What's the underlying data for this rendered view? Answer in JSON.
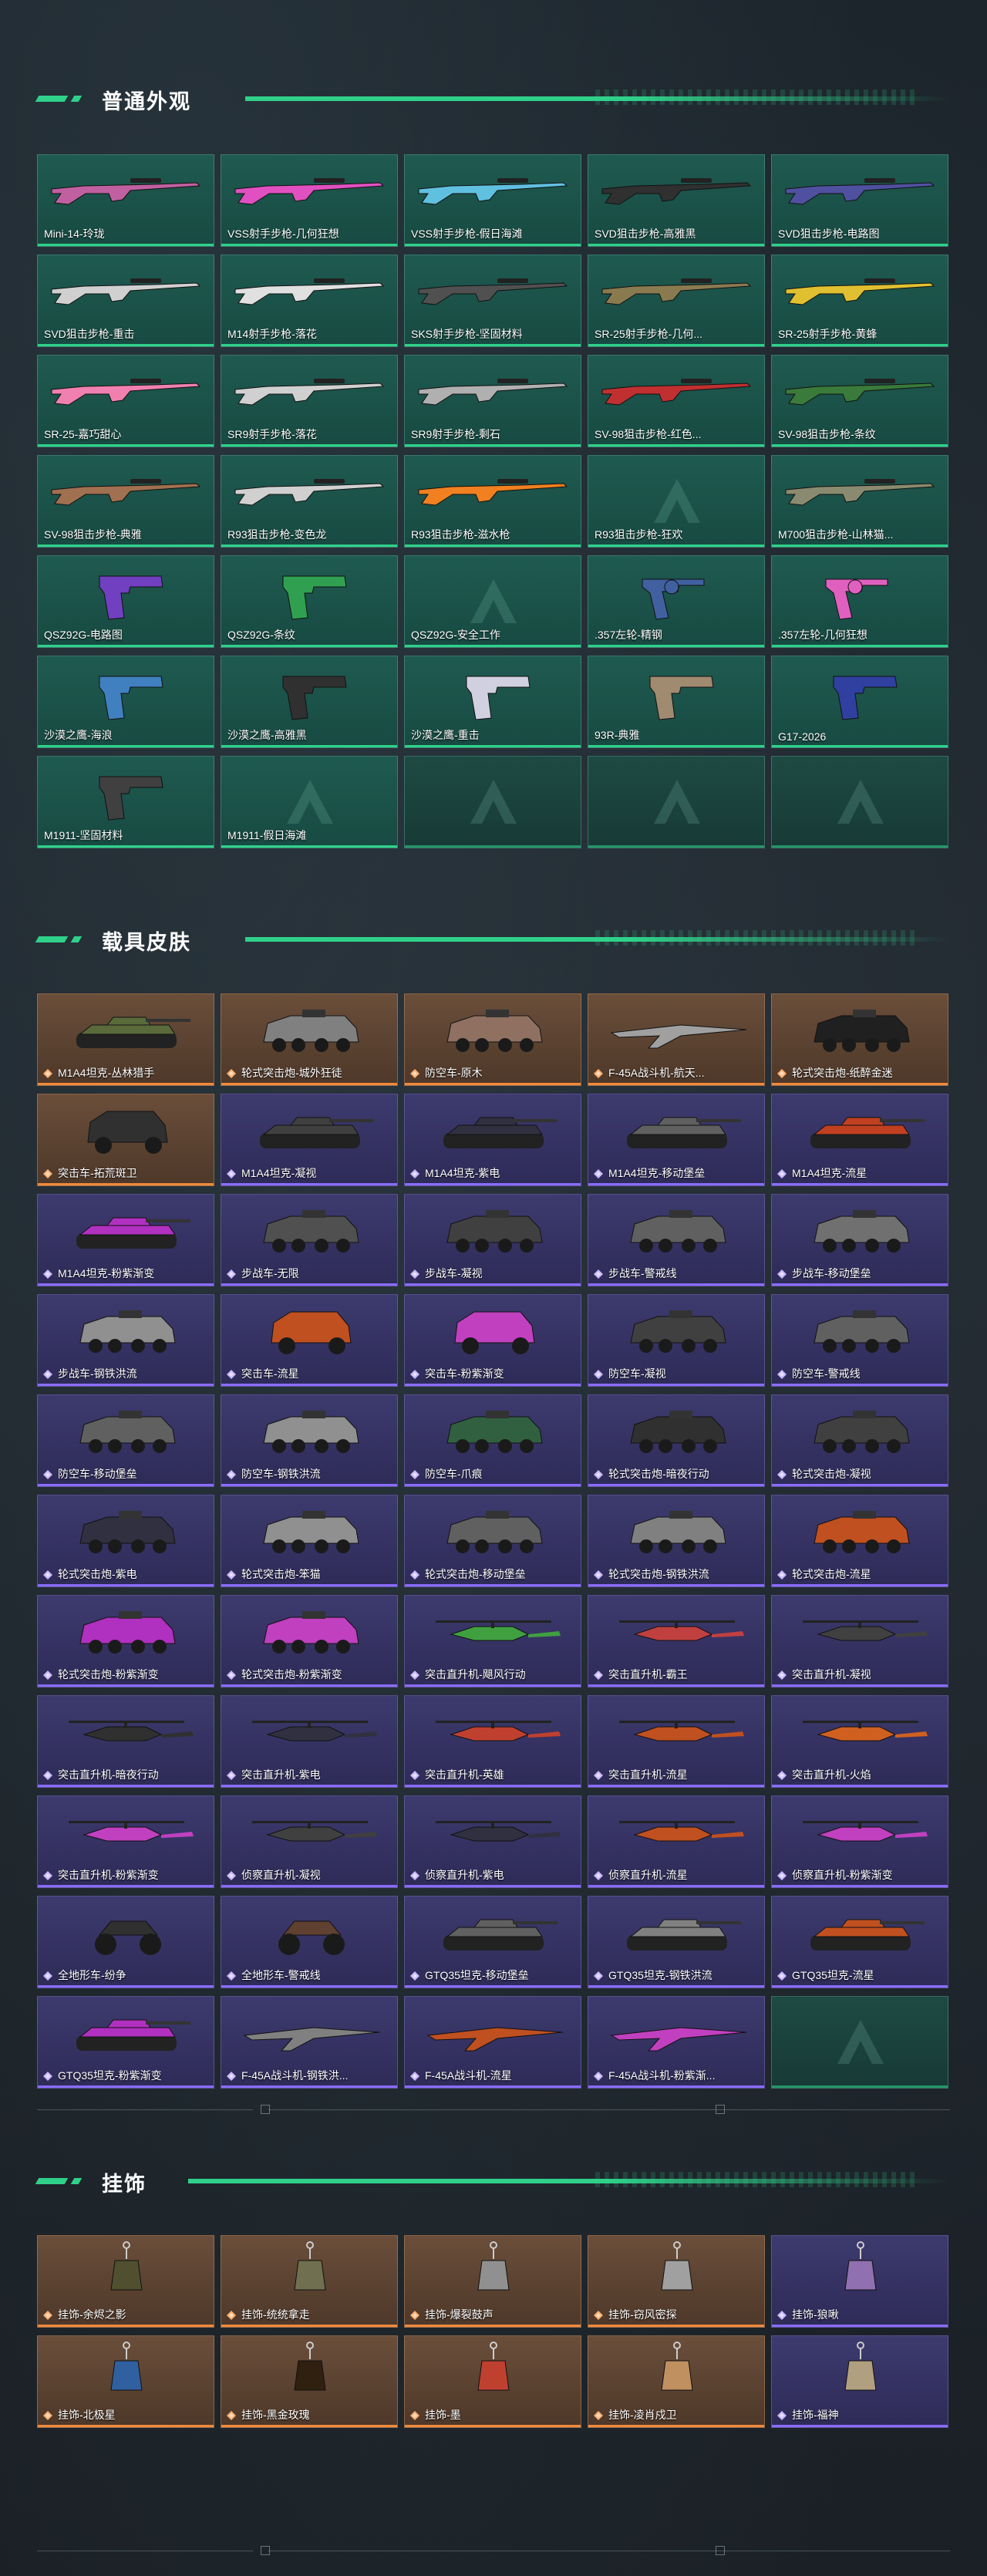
{
  "sections": [
    {
      "title": "普通外观",
      "items": [
        {
          "label": "Mini-14-玲珑",
          "kind": "rifle",
          "color": "#c060a0"
        },
        {
          "label": "VSS射手步枪-几何狂想",
          "kind": "rifle",
          "color": "#e050c0"
        },
        {
          "label": "VSS射手步枪-假日海滩",
          "kind": "rifle",
          "color": "#60c0e0"
        },
        {
          "label": "SVD狙击步枪-高雅黑",
          "kind": "rifle",
          "color": "#303030"
        },
        {
          "label": "SVD狙击步枪-电路图",
          "kind": "rifle",
          "color": "#5050a0"
        },
        {
          "label": "SVD狙击步枪-重击",
          "kind": "rifle",
          "color": "#d0d0d0"
        },
        {
          "label": "M14射手步枪-落花",
          "kind": "rifle",
          "color": "#e0e0e0"
        },
        {
          "label": "SKS射手步枪-坚固材料",
          "kind": "rifle",
          "color": "#505050"
        },
        {
          "label": "SR-25射手步枪-几何...",
          "kind": "rifle",
          "color": "#8a7a50"
        },
        {
          "label": "SR-25射手步枪-黄蜂",
          "kind": "rifle",
          "color": "#e0c030"
        },
        {
          "label": "SR-25-嘉巧甜心",
          "kind": "rifle",
          "color": "#f080b0"
        },
        {
          "label": "SR9射手步枪-落花",
          "kind": "rifle",
          "color": "#d0d0d0"
        },
        {
          "label": "SR9射手步枪-剩石",
          "kind": "rifle",
          "color": "#b0b0b0"
        },
        {
          "label": "SV-98狙击步枪-红色...",
          "kind": "rifle",
          "color": "#c03030"
        },
        {
          "label": "SV-98狙击步枪-条纹",
          "kind": "rifle",
          "color": "#3a7a3a"
        },
        {
          "label": "SV-98狙击步枪-典雅",
          "kind": "rifle",
          "color": "#a07050"
        },
        {
          "label": "R93狙击步枪-变色龙",
          "kind": "rifle",
          "color": "#d0d0d0"
        },
        {
          "label": "R93狙击步枪-滋水枪",
          "kind": "rifle",
          "color": "#f08020"
        },
        {
          "label": "R93狙击步枪-狂欢",
          "kind": "empty",
          "color": ""
        },
        {
          "label": "M700狙击步枪-山林猫...",
          "kind": "rifle",
          "color": "#8a8a70"
        },
        {
          "label": "QSZ92G-电路图",
          "kind": "pistol",
          "color": "#7040c0"
        },
        {
          "label": "QSZ92G-条纹",
          "kind": "pistol",
          "color": "#30a050"
        },
        {
          "label": "QSZ92G-安全工作",
          "kind": "empty",
          "color": ""
        },
        {
          "label": ".357左轮-精钢",
          "kind": "revolver",
          "color": "#4060a0"
        },
        {
          "label": ".357左轮-几何狂想",
          "kind": "revolver",
          "color": "#e060c0"
        },
        {
          "label": "沙漠之鹰-海浪",
          "kind": "pistol",
          "color": "#4080c0"
        },
        {
          "label": "沙漠之鹰-高雅黑",
          "kind": "pistol",
          "color": "#303030"
        },
        {
          "label": "沙漠之鹰-重击",
          "kind": "pistol",
          "color": "#d0d0e0"
        },
        {
          "label": "93R-典雅",
          "kind": "pistol",
          "color": "#a08a70"
        },
        {
          "label": "G17-2026",
          "kind": "pistol",
          "color": "#3040a0"
        },
        {
          "label": "M1911-坚固材料",
          "kind": "pistol",
          "color": "#404040"
        },
        {
          "label": "M1911-假日海滩",
          "kind": "empty",
          "color": ""
        }
      ]
    },
    {
      "title": "载具皮肤",
      "items": [
        {
          "label": "M1A4坦克-丛林猎手",
          "tier": "orange",
          "kind": "tank",
          "color": "#5a6a3a"
        },
        {
          "label": "轮式突击炮-城外狂徒",
          "tier": "orange",
          "kind": "apc",
          "color": "#808080"
        },
        {
          "label": "防空车-原木",
          "tier": "orange",
          "kind": "apc",
          "color": "#907060"
        },
        {
          "label": "F-45A战斗机-航天...",
          "tier": "orange",
          "kind": "jet",
          "color": "#a0a0a0"
        },
        {
          "label": "轮式突击炮-纸醉金迷",
          "tier": "orange",
          "kind": "apc",
          "color": "#202020"
        },
        {
          "label": "突击车-拓荒斑卫",
          "tier": "orange",
          "kind": "truck",
          "color": "#303030"
        },
        {
          "label": "M1A4坦克-凝视",
          "tier": "purple",
          "kind": "tank",
          "color": "#404040"
        },
        {
          "label": "M1A4坦克-紫电",
          "tier": "purple",
          "kind": "tank",
          "color": "#303040"
        },
        {
          "label": "M1A4坦克-移动堡垒",
          "tier": "purple",
          "kind": "tank",
          "color": "#606060"
        },
        {
          "label": "M1A4坦克-流星",
          "tier": "purple",
          "kind": "tank",
          "color": "#c04020"
        },
        {
          "label": "M1A4坦克-粉紫渐变",
          "tier": "purple",
          "kind": "tank",
          "color": "#b030c0"
        },
        {
          "label": "步战车-无限",
          "tier": "purple",
          "kind": "apc",
          "color": "#505050"
        },
        {
          "label": "步战车-凝视",
          "tier": "purple",
          "kind": "apc",
          "color": "#404040"
        },
        {
          "label": "步战车-警戒线",
          "tier": "purple",
          "kind": "apc",
          "color": "#606060"
        },
        {
          "label": "步战车-移动堡垒",
          "tier": "purple",
          "kind": "apc",
          "color": "#707070"
        },
        {
          "label": "步战车-钢铁洪流",
          "tier": "purple",
          "kind": "apc",
          "color": "#909090"
        },
        {
          "label": "突击车-流星",
          "tier": "purple",
          "kind": "truck",
          "color": "#c05020"
        },
        {
          "label": "突击车-粉紫渐变",
          "tier": "purple",
          "kind": "truck",
          "color": "#c040c0"
        },
        {
          "label": "防空车-凝视",
          "tier": "purple",
          "kind": "apc",
          "color": "#404040"
        },
        {
          "label": "防空车-警戒线",
          "tier": "purple",
          "kind": "apc",
          "color": "#606060"
        },
        {
          "label": "防空车-移动堡垒",
          "tier": "purple",
          "kind": "apc",
          "color": "#606060"
        },
        {
          "label": "防空车-钢铁洪流",
          "tier": "purple",
          "kind": "apc",
          "color": "#909090"
        },
        {
          "label": "防空车-爪痕",
          "tier": "purple",
          "kind": "apc",
          "color": "#306040"
        },
        {
          "label": "轮式突击炮-暗夜行动",
          "tier": "purple",
          "kind": "apc",
          "color": "#303030"
        },
        {
          "label": "轮式突击炮-凝视",
          "tier": "purple",
          "kind": "apc",
          "color": "#404040"
        },
        {
          "label": "轮式突击炮-紫电",
          "tier": "purple",
          "kind": "apc",
          "color": "#303040"
        },
        {
          "label": "轮式突击炮-笨猫",
          "tier": "purple",
          "kind": "apc",
          "color": "#909090"
        },
        {
          "label": "轮式突击炮-移动堡垒",
          "tier": "purple",
          "kind": "apc",
          "color": "#606060"
        },
        {
          "label": "轮式突击炮-钢铁洪流",
          "tier": "purple",
          "kind": "apc",
          "color": "#808080"
        },
        {
          "label": "轮式突击炮-流星",
          "tier": "purple",
          "kind": "apc",
          "color": "#c05020"
        },
        {
          "label": "轮式突击炮-粉紫渐变",
          "tier": "purple",
          "kind": "apc",
          "color": "#b030c0"
        },
        {
          "label": "轮式突击炮-粉紫渐变",
          "tier": "purple",
          "kind": "apc",
          "color": "#c040c0"
        },
        {
          "label": "突击直升机-飓风行动",
          "tier": "purple",
          "kind": "heli",
          "color": "#40a040"
        },
        {
          "label": "突击直升机-霸王",
          "tier": "purple",
          "kind": "heli",
          "color": "#c04040"
        },
        {
          "label": "突击直升机-凝视",
          "tier": "purple",
          "kind": "heli",
          "color": "#404040"
        },
        {
          "label": "突击直升机-暗夜行动",
          "tier": "purple",
          "kind": "heli",
          "color": "#303030"
        },
        {
          "label": "突击直升机-紫电",
          "tier": "purple",
          "kind": "heli",
          "color": "#303040"
        },
        {
          "label": "突击直升机-英雄",
          "tier": "purple",
          "kind": "heli",
          "color": "#c04030"
        },
        {
          "label": "突击直升机-流星",
          "tier": "purple",
          "kind": "heli",
          "color": "#c05020"
        },
        {
          "label": "突击直升机-火焰",
          "tier": "purple",
          "kind": "heli",
          "color": "#d06020"
        },
        {
          "label": "突击直升机-粉紫渐变",
          "tier": "purple",
          "kind": "heli",
          "color": "#c040c0"
        },
        {
          "label": "侦察直升机-凝视",
          "tier": "purple",
          "kind": "heli",
          "color": "#404040"
        },
        {
          "label": "侦察直升机-紫电",
          "tier": "purple",
          "kind": "heli",
          "color": "#303040"
        },
        {
          "label": "侦察直升机-流星",
          "tier": "purple",
          "kind": "heli",
          "color": "#c05020"
        },
        {
          "label": "侦察直升机-粉紫渐变",
          "tier": "purple",
          "kind": "heli",
          "color": "#c040c0"
        },
        {
          "label": "全地形车-纷争",
          "tier": "purple",
          "kind": "atv",
          "color": "#303030"
        },
        {
          "label": "全地形车-警戒线",
          "tier": "purple",
          "kind": "atv",
          "color": "#604030"
        },
        {
          "label": "GTQ35坦克-移动堡垒",
          "tier": "purple",
          "kind": "tank",
          "color": "#606060"
        },
        {
          "label": "GTQ35坦克-钢铁洪流",
          "tier": "purple",
          "kind": "tank",
          "color": "#808080"
        },
        {
          "label": "GTQ35坦克-流星",
          "tier": "purple",
          "kind": "tank",
          "color": "#c05020"
        },
        {
          "label": "GTQ35坦克-粉紫渐变",
          "tier": "purple",
          "kind": "tank",
          "color": "#b030c0"
        },
        {
          "label": "F-45A战斗机-钢铁洪...",
          "tier": "purple",
          "kind": "jet",
          "color": "#808080"
        },
        {
          "label": "F-45A战斗机-流星",
          "tier": "purple",
          "kind": "jet",
          "color": "#c05020"
        },
        {
          "label": "F-45A战斗机-粉紫渐...",
          "tier": "purple",
          "kind": "jet",
          "color": "#c040c0"
        },
        {
          "label": "",
          "tier": "empty",
          "kind": "empty",
          "color": ""
        }
      ]
    },
    {
      "title": "挂饰",
      "items": [
        {
          "label": "挂饰-余烬之影",
          "tier": "orange",
          "color": "#505030"
        },
        {
          "label": "挂饰-统统拿走",
          "tier": "orange",
          "color": "#707050"
        },
        {
          "label": "挂饰-爆裂鼓声",
          "tier": "orange",
          "color": "#909090"
        },
        {
          "label": "挂饰-窃风密探",
          "tier": "orange",
          "color": "#a0a0a0"
        },
        {
          "label": "挂饰-狼啾",
          "tier": "purple",
          "color": "#9070b0"
        },
        {
          "label": "挂饰-北极星",
          "tier": "orange",
          "color": "#3060a0"
        },
        {
          "label": "挂饰-黑金玫瑰",
          "tier": "orange",
          "color": "#302010"
        },
        {
          "label": "挂饰-墨",
          "tier": "orange",
          "color": "#c04030"
        },
        {
          "label": "挂饰-凌肖戍卫",
          "tier": "orange",
          "color": "#c09060"
        },
        {
          "label": "挂饰-福神",
          "tier": "purple",
          "color": "#b0a080"
        }
      ]
    }
  ]
}
